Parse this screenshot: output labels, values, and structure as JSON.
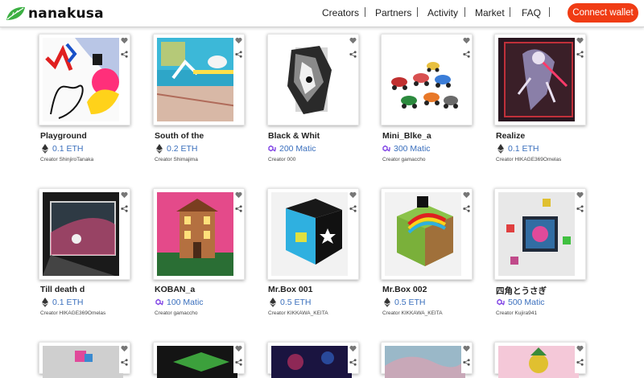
{
  "brand": {
    "name": "nanakusa"
  },
  "nav": {
    "items": [
      "Creators",
      "Partners",
      "Activity",
      "Market",
      "FAQ"
    ],
    "connect_label": "Connect wallet"
  },
  "colors": {
    "accent": "#f03c14",
    "price": "#3a6fbd",
    "brand_green": "#3cb043"
  },
  "cards": [
    {
      "title": "Playground",
      "currency": "eth",
      "price": "0.1 ETH",
      "creator": "Creator ShinjiroTanaka"
    },
    {
      "title": "South of the",
      "currency": "eth",
      "price": "0.2 ETH",
      "creator": "Creator Shimajima"
    },
    {
      "title": "Black & Whit",
      "currency": "matic",
      "price": "200 Matic",
      "creator": "Creator 000"
    },
    {
      "title": "Mini_Blke_a",
      "currency": "matic",
      "price": "300 Matic",
      "creator": "Creator gamaccho"
    },
    {
      "title": "Realize",
      "currency": "eth",
      "price": "0.1 ETH",
      "creator": "Creator HIKAGE369Omelas"
    },
    {
      "title": "Till death d",
      "currency": "eth",
      "price": "0.1 ETH",
      "creator": "Creator HIKAGE369Omelas"
    },
    {
      "title": "KOBAN_a",
      "currency": "matic",
      "price": "100 Matic",
      "creator": "Creator gamaccho"
    },
    {
      "title": "Mr.Box 001",
      "currency": "eth",
      "price": "0.5 ETH",
      "creator": "Creator KIKKAWA_KEITA"
    },
    {
      "title": "Mr.Box 002",
      "currency": "eth",
      "price": "0.5 ETH",
      "creator": "Creator KIKKAWA_KEITA"
    },
    {
      "title": "四角とうさぎ",
      "currency": "matic",
      "price": "500 Matic",
      "creator": "Creator Kujira941"
    }
  ]
}
